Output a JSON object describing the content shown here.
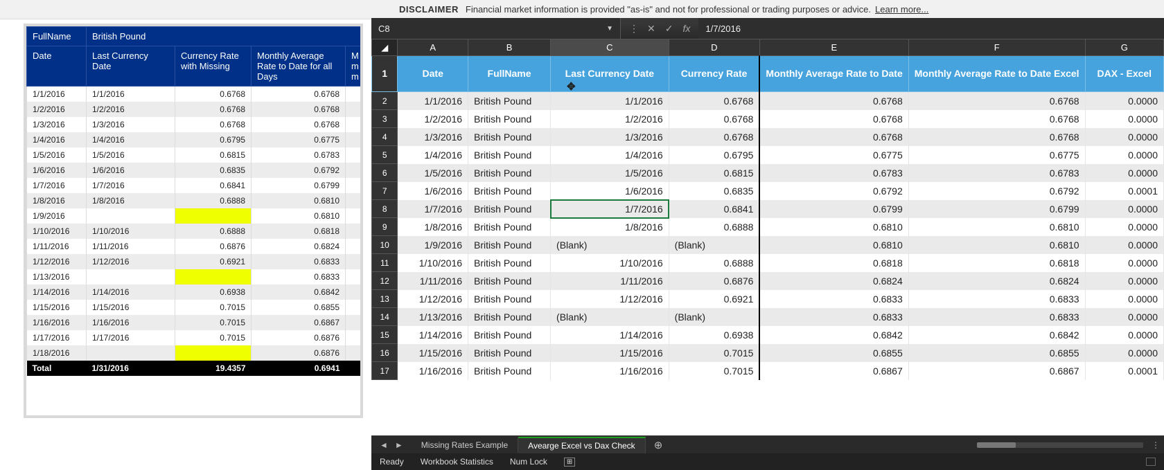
{
  "disclaimer": {
    "label": "DISCLAIMER",
    "text": "Financial market information is provided \"as-is\" and not for professional or trading purposes or advice.",
    "link": "Learn more..."
  },
  "pivot": {
    "top": {
      "fullname_label": "FullName",
      "fullname_value": "British Pound"
    },
    "cols": [
      "Date",
      "Last Currency Date",
      "Currency Rate with Missing",
      "Monthly Average Rate to Date for all Days",
      "M m m"
    ],
    "rows": [
      {
        "date": "1/1/2016",
        "lcd": "1/1/2016",
        "rate": "0.6768",
        "avg": "0.6768"
      },
      {
        "date": "1/2/2016",
        "lcd": "1/2/2016",
        "rate": "0.6768",
        "avg": "0.6768"
      },
      {
        "date": "1/3/2016",
        "lcd": "1/3/2016",
        "rate": "0.6768",
        "avg": "0.6768"
      },
      {
        "date": "1/4/2016",
        "lcd": "1/4/2016",
        "rate": "0.6795",
        "avg": "0.6775"
      },
      {
        "date": "1/5/2016",
        "lcd": "1/5/2016",
        "rate": "0.6815",
        "avg": "0.6783"
      },
      {
        "date": "1/6/2016",
        "lcd": "1/6/2016",
        "rate": "0.6835",
        "avg": "0.6792"
      },
      {
        "date": "1/7/2016",
        "lcd": "1/7/2016",
        "rate": "0.6841",
        "avg": "0.6799"
      },
      {
        "date": "1/8/2016",
        "lcd": "1/8/2016",
        "rate": "0.6888",
        "avg": "0.6810"
      },
      {
        "date": "1/9/2016",
        "lcd": "",
        "rate": "",
        "avg": "0.6810",
        "hl": true
      },
      {
        "date": "1/10/2016",
        "lcd": "1/10/2016",
        "rate": "0.6888",
        "avg": "0.6818"
      },
      {
        "date": "1/11/2016",
        "lcd": "1/11/2016",
        "rate": "0.6876",
        "avg": "0.6824"
      },
      {
        "date": "1/12/2016",
        "lcd": "1/12/2016",
        "rate": "0.6921",
        "avg": "0.6833"
      },
      {
        "date": "1/13/2016",
        "lcd": "",
        "rate": "",
        "avg": "0.6833",
        "hl": true
      },
      {
        "date": "1/14/2016",
        "lcd": "1/14/2016",
        "rate": "0.6938",
        "avg": "0.6842"
      },
      {
        "date": "1/15/2016",
        "lcd": "1/15/2016",
        "rate": "0.7015",
        "avg": "0.6855"
      },
      {
        "date": "1/16/2016",
        "lcd": "1/16/2016",
        "rate": "0.7015",
        "avg": "0.6867"
      },
      {
        "date": "1/17/2016",
        "lcd": "1/17/2016",
        "rate": "0.7015",
        "avg": "0.6876"
      },
      {
        "date": "1/18/2016",
        "lcd": "",
        "rate": "",
        "avg": "0.6876",
        "hl": true
      }
    ],
    "total": {
      "label": "Total",
      "lcd": "1/31/2016",
      "rate": "19.4357",
      "avg": "0.6941"
    }
  },
  "workbook": {
    "name_box": "C8",
    "formula": "1/7/2016",
    "columns": [
      "A",
      "B",
      "C",
      "D",
      "E",
      "F",
      "G"
    ],
    "active_col": "C",
    "headers": [
      "Date",
      "FullName",
      "Last Currency Date",
      "Currency Rate",
      "Monthly Average Rate to Date",
      "Monthly Average Rate to Date Excel",
      "DAX - Excel"
    ],
    "rows": [
      {
        "r": 2,
        "d": "1/1/2016",
        "fn": "British Pound",
        "lcd": "1/1/2016",
        "cr": "0.6768",
        "m1": "0.6768",
        "m2": "0.6768",
        "dx": "0.0000"
      },
      {
        "r": 3,
        "d": "1/2/2016",
        "fn": "British Pound",
        "lcd": "1/2/2016",
        "cr": "0.6768",
        "m1": "0.6768",
        "m2": "0.6768",
        "dx": "0.0000"
      },
      {
        "r": 4,
        "d": "1/3/2016",
        "fn": "British Pound",
        "lcd": "1/3/2016",
        "cr": "0.6768",
        "m1": "0.6768",
        "m2": "0.6768",
        "dx": "0.0000"
      },
      {
        "r": 5,
        "d": "1/4/2016",
        "fn": "British Pound",
        "lcd": "1/4/2016",
        "cr": "0.6795",
        "m1": "0.6775",
        "m2": "0.6775",
        "dx": "0.0000"
      },
      {
        "r": 6,
        "d": "1/5/2016",
        "fn": "British Pound",
        "lcd": "1/5/2016",
        "cr": "0.6815",
        "m1": "0.6783",
        "m2": "0.6783",
        "dx": "0.0000"
      },
      {
        "r": 7,
        "d": "1/6/2016",
        "fn": "British Pound",
        "lcd": "1/6/2016",
        "cr": "0.6835",
        "m1": "0.6792",
        "m2": "0.6792",
        "dx": "0.0001"
      },
      {
        "r": 8,
        "d": "1/7/2016",
        "fn": "British Pound",
        "lcd": "1/7/2016",
        "cr": "0.6841",
        "m1": "0.6799",
        "m2": "0.6799",
        "dx": "0.0000",
        "sel": true
      },
      {
        "r": 9,
        "d": "1/8/2016",
        "fn": "British Pound",
        "lcd": "1/8/2016",
        "cr": "0.6888",
        "m1": "0.6810",
        "m2": "0.6810",
        "dx": "0.0000"
      },
      {
        "r": 10,
        "d": "1/9/2016",
        "fn": "British Pound",
        "lcd": "(Blank)",
        "cr": "(Blank)",
        "m1": "0.6810",
        "m2": "0.6810",
        "dx": "0.0000"
      },
      {
        "r": 11,
        "d": "1/10/2016",
        "fn": "British Pound",
        "lcd": "1/10/2016",
        "cr": "0.6888",
        "m1": "0.6818",
        "m2": "0.6818",
        "dx": "0.0000"
      },
      {
        "r": 12,
        "d": "1/11/2016",
        "fn": "British Pound",
        "lcd": "1/11/2016",
        "cr": "0.6876",
        "m1": "0.6824",
        "m2": "0.6824",
        "dx": "0.0000"
      },
      {
        "r": 13,
        "d": "1/12/2016",
        "fn": "British Pound",
        "lcd": "1/12/2016",
        "cr": "0.6921",
        "m1": "0.6833",
        "m2": "0.6833",
        "dx": "0.0000"
      },
      {
        "r": 14,
        "d": "1/13/2016",
        "fn": "British Pound",
        "lcd": "(Blank)",
        "cr": "(Blank)",
        "m1": "0.6833",
        "m2": "0.6833",
        "dx": "0.0000"
      },
      {
        "r": 15,
        "d": "1/14/2016",
        "fn": "British Pound",
        "lcd": "1/14/2016",
        "cr": "0.6938",
        "m1": "0.6842",
        "m2": "0.6842",
        "dx": "0.0000"
      },
      {
        "r": 16,
        "d": "1/15/2016",
        "fn": "British Pound",
        "lcd": "1/15/2016",
        "cr": "0.7015",
        "m1": "0.6855",
        "m2": "0.6855",
        "dx": "0.0000"
      },
      {
        "r": 17,
        "d": "1/16/2016",
        "fn": "British Pound",
        "lcd": "1/16/2016",
        "cr": "0.7015",
        "m1": "0.6867",
        "m2": "0.6867",
        "dx": "0.0001"
      }
    ],
    "tabs": {
      "inactive": "Missing Rates Example",
      "active": "Avearge Excel vs Dax Check"
    },
    "status": {
      "ready": "Ready",
      "stats": "Workbook Statistics",
      "num": "Num Lock"
    }
  }
}
